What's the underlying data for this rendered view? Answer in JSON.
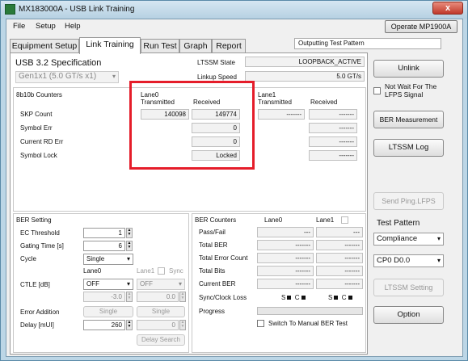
{
  "window": {
    "title": "MX183000A - USB Link Training",
    "close": "x"
  },
  "menu": {
    "file": "File",
    "setup": "Setup",
    "help": "Help",
    "operate_btn": "Operate MP1900A"
  },
  "tabs": [
    "Equipment Setup",
    "Link Training",
    "Run Test",
    "Graph",
    "Report"
  ],
  "status": "Outputting Test Pattern",
  "spec": {
    "label": "USB 3.2 Specification",
    "value": "Gen1x1 (5.0 GT/s x1)"
  },
  "ltssm": {
    "state_label": "LTSSM State",
    "state_value": "LOOPBACK_ACTIVE",
    "speed_label": "Linkup Speed",
    "speed_value": "5.0 GT/s"
  },
  "counters": {
    "title": "8b10b Counters",
    "lane0": "Lane0",
    "lane1": "Lane1",
    "transmitted": "Transmitted",
    "received": "Received",
    "rows": [
      {
        "label": "SKP Count",
        "l0_tx": "140098",
        "l0_rx": "149774",
        "l1_tx": "-------",
        "l1_rx": "-------"
      },
      {
        "label": "Symbol Err",
        "l0_tx": "",
        "l0_rx": "0",
        "l1_tx": "",
        "l1_rx": "-------"
      },
      {
        "label": "Current RD Err",
        "l0_tx": "",
        "l0_rx": "0",
        "l1_tx": "",
        "l1_rx": "-------"
      },
      {
        "label": "Symbol Lock",
        "l0_tx": "",
        "l0_rx": "Locked",
        "l1_tx": "",
        "l1_rx": "-------"
      }
    ]
  },
  "ber_setting": {
    "title": "BER Setting",
    "ec_label": "EC Threshold",
    "ec_value": "1",
    "gating_label": "Gating Time [s]",
    "gating_value": "6",
    "cycle_label": "Cycle",
    "cycle_value": "Single",
    "lane0": "Lane0",
    "lane1": "Lane1",
    "sync": "Sync",
    "ctle_label": "CTLE [dB]",
    "ctle_l0": "OFF",
    "ctle_l1": "OFF",
    "ctle_l0_val": "-3.0",
    "ctle_l1_val": "0.0",
    "err_add_label": "Error Addition",
    "err_add_l0": "Single",
    "err_add_l1": "Single",
    "delay_label": "Delay [mUI]",
    "delay_l0": "260",
    "delay_l1": "0",
    "delay_search": "Delay Search"
  },
  "ber_counters": {
    "title": "BER Counters",
    "lane0": "Lane0",
    "lane1": "Lane1",
    "rows": [
      {
        "label": "Pass/Fail",
        "l0": "---",
        "l1": "---"
      },
      {
        "label": "Total BER",
        "l0": "-------",
        "l1": "-------"
      },
      {
        "label": "Total Error Count",
        "l0": "-------",
        "l1": "-------"
      },
      {
        "label": "Total Bits",
        "l0": "-------",
        "l1": "-------"
      },
      {
        "label": "Current BER",
        "l0": "-------",
        "l1": "-------"
      }
    ],
    "sync_label": "Sync/Clock Loss",
    "s": "S",
    "c": "C",
    "progress_label": "Progress",
    "manual_label": "Switch To Manual BER Test"
  },
  "right": {
    "unlink": "Unlink",
    "not_wait": "Not Wait For The",
    "lfps_signal": "LFPS Signal",
    "ber_measurement": "BER Measurement",
    "ltssm_log": "LTSSM Log",
    "send_ping": "Send Ping.LFPS",
    "test_pattern_label": "Test Pattern",
    "test_pattern": "Compliance",
    "cp": "CP0 D0.0",
    "ltssm_setting": "LTSSM Setting",
    "option": "Option"
  },
  "colors": {
    "highlight": "#e51d2a",
    "titlebar": "#bcd6e6"
  }
}
